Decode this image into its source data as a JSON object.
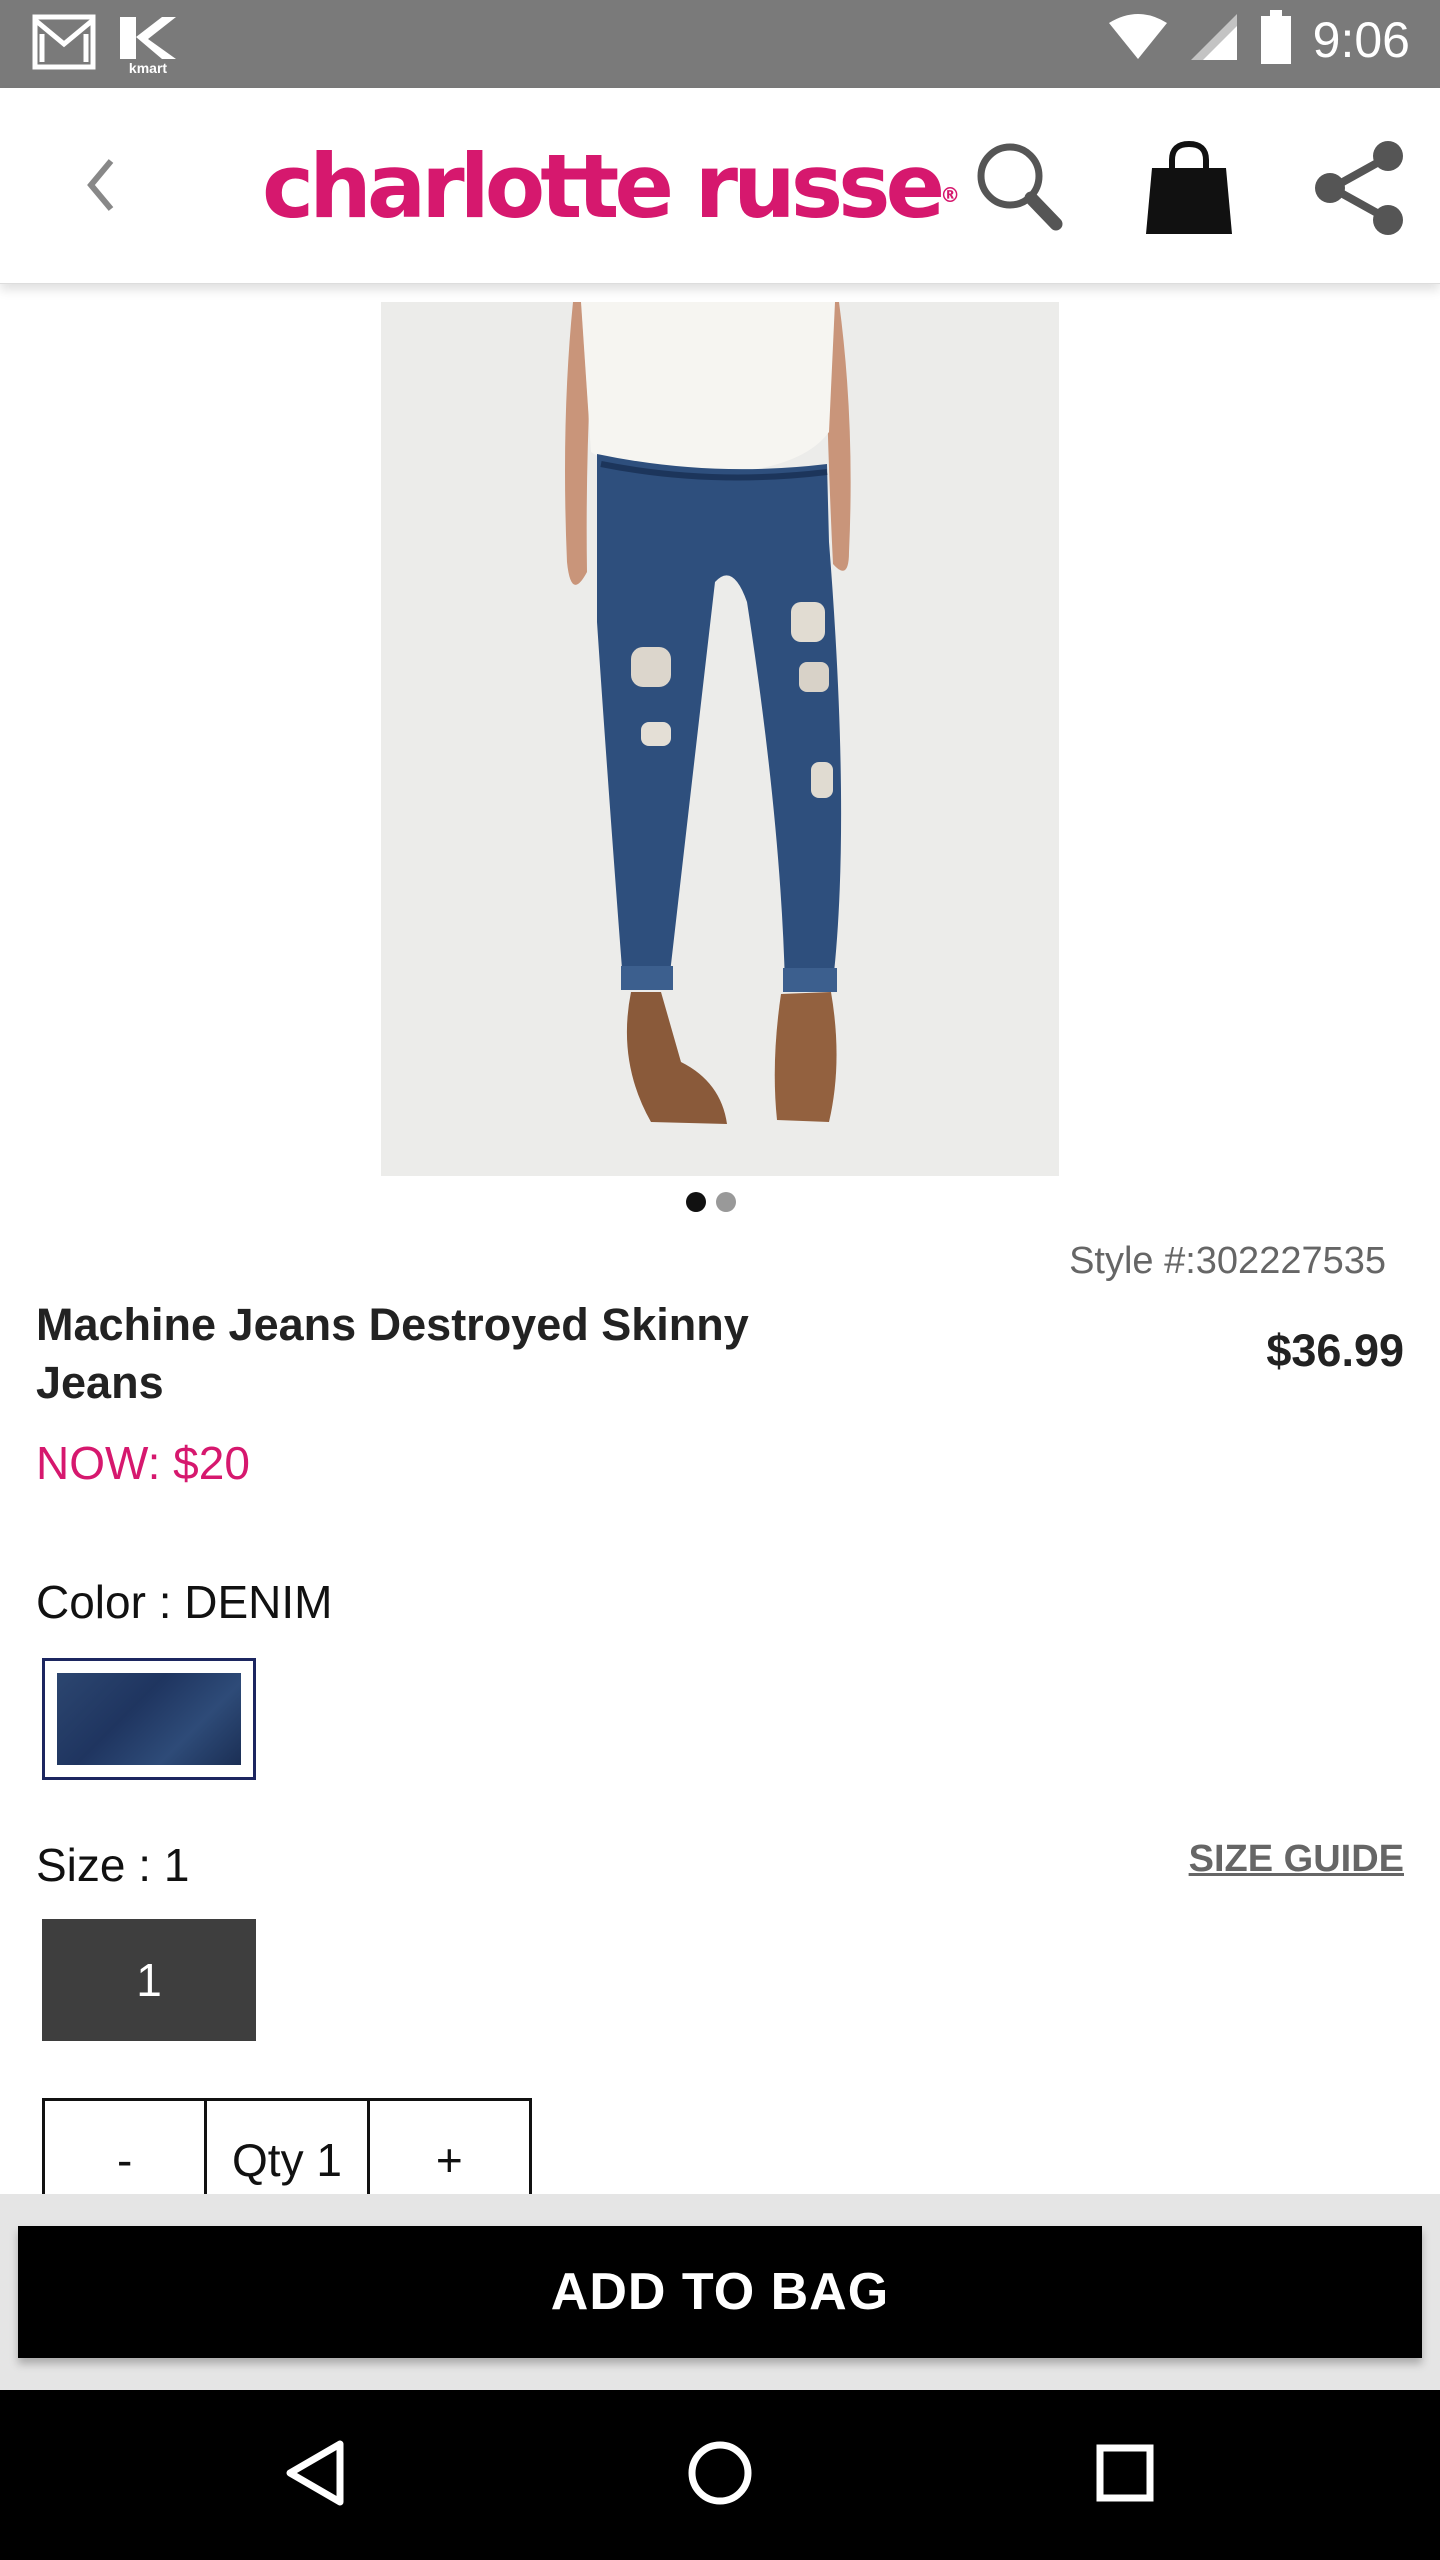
{
  "status_bar": {
    "time": "9:06",
    "left_icons": [
      "gmail-icon",
      "kmart-icon"
    ],
    "kmart_label": "kmart",
    "right_icons": [
      "wifi-icon",
      "cell-signal-icon",
      "battery-icon"
    ]
  },
  "header": {
    "brand": "charlotte russe",
    "brand_mark": "®",
    "icons": [
      "back-icon",
      "search-icon",
      "shopping-bag-icon",
      "share-icon"
    ]
  },
  "product": {
    "style_number": "Style #:302227535",
    "title": "Machine Jeans Destroyed Skinny Jeans",
    "price": "$36.99",
    "sale_price": "NOW: $20",
    "image_count": 2,
    "active_image": 1
  },
  "options": {
    "color_label": "Color : DENIM",
    "size_label": "Size : 1",
    "size_guide": "SIZE GUIDE",
    "sizes": [
      "1"
    ]
  },
  "quantity": {
    "decrement": "-",
    "label": "Qty 1",
    "increment": "+"
  },
  "cta": {
    "add_to_bag": "ADD TO BAG"
  },
  "nav": {
    "icons": [
      "back-triangle-icon",
      "home-circle-icon",
      "recents-square-icon"
    ]
  },
  "colors": {
    "brand": "#d6186e",
    "status_bar": "#7a7a7a",
    "button": "#000000",
    "size_selected": "#3e3e3e"
  }
}
